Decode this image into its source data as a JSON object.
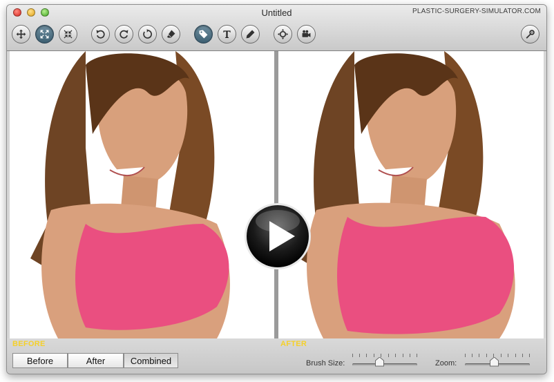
{
  "window": {
    "title": "Untitled",
    "site": "PLASTIC-SURGERY-SIMULATOR.COM"
  },
  "toolbar": {
    "items": [
      {
        "name": "move-tool",
        "icon": "move-arrows-icon",
        "active": false
      },
      {
        "name": "expand-tool",
        "icon": "expand-arrows-icon",
        "active": true
      },
      {
        "name": "shrink-tool",
        "icon": "shrink-arrows-icon",
        "active": false
      },
      {
        "name": "rotate-left",
        "icon": "rotate-ccw-icon",
        "active": false
      },
      {
        "name": "rotate-right",
        "icon": "rotate-cw-icon",
        "active": false
      },
      {
        "name": "reset",
        "icon": "reset-icon",
        "active": false
      },
      {
        "name": "eraser",
        "icon": "eraser-icon",
        "active": false
      },
      {
        "name": "tag-tool",
        "icon": "tag-icon",
        "active": true
      },
      {
        "name": "text-tool",
        "icon": "text-icon",
        "active": false
      },
      {
        "name": "pencil-tool",
        "icon": "pencil-icon",
        "active": false
      },
      {
        "name": "zoom-tool",
        "icon": "zoom-icon",
        "active": false
      },
      {
        "name": "video-tool",
        "icon": "video-camera-icon",
        "active": false
      },
      {
        "name": "settings",
        "icon": "wrench-gear-icon",
        "active": false
      }
    ]
  },
  "panels": {
    "before_label": "BEFORE",
    "after_label": "AFTER"
  },
  "view_modes": {
    "before": "Before",
    "after": "After",
    "combined": "Combined",
    "selected": "Combined"
  },
  "controls": {
    "brush_label": "Brush Size:",
    "brush_value": 0.42,
    "zoom_label": "Zoom:",
    "zoom_value": 0.45
  },
  "colors": {
    "label_yellow": "#f5d02a",
    "top_pink": "#ec4f82",
    "active_button": "#4a6b7e"
  }
}
